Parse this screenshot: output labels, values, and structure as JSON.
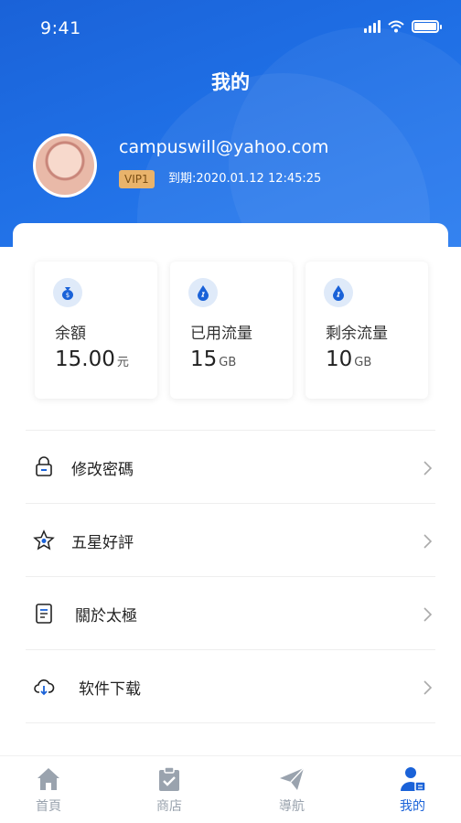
{
  "status_bar": {
    "time": "9:41"
  },
  "header": {
    "title": "我的"
  },
  "profile": {
    "email": "campuswill@yahoo.com",
    "vip_badge": "VIP1",
    "expire_text": "到期:2020.01.12 12:45:25"
  },
  "stats": [
    {
      "label": "余額",
      "value": "15.00",
      "unit": "元",
      "icon": "money-bag-icon"
    },
    {
      "label": "已用流量",
      "value": "15",
      "unit": "GB",
      "icon": "drop-icon"
    },
    {
      "label": "剩余流量",
      "value": "10",
      "unit": "GB",
      "icon": "drop-icon"
    }
  ],
  "menu": [
    {
      "label": "修改密碼",
      "icon": "lock-icon"
    },
    {
      "label": "五星好評",
      "icon": "star-icon"
    },
    {
      "label": "關於太極",
      "icon": "document-icon"
    },
    {
      "label": "软件下载",
      "icon": "cloud-download-icon"
    }
  ],
  "tabs": [
    {
      "label": "首頁",
      "icon": "home-icon",
      "active": false
    },
    {
      "label": "商店",
      "icon": "clipboard-icon",
      "active": false
    },
    {
      "label": "導航",
      "icon": "paper-plane-icon",
      "active": false
    },
    {
      "label": "我的",
      "icon": "user-icon",
      "active": true
    }
  ],
  "colors": {
    "primary": "#1a62d8",
    "vip_gold": "#e9b36b",
    "tab_inactive": "#9aa3ae"
  }
}
